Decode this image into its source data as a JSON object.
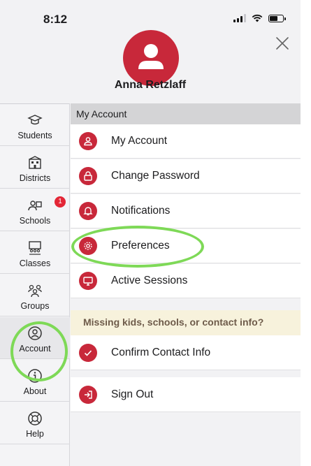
{
  "status_bar": {
    "time": "8:12"
  },
  "header": {
    "user_name": "Anna Retzlaff"
  },
  "sidebar": {
    "items": [
      {
        "label": "Students",
        "icon": "graduation-cap-icon"
      },
      {
        "label": "Districts",
        "icon": "building-icon"
      },
      {
        "label": "Schools",
        "icon": "school-icon",
        "badge": "1"
      },
      {
        "label": "Classes",
        "icon": "classroom-icon"
      },
      {
        "label": "Groups",
        "icon": "group-icon"
      },
      {
        "label": "Account",
        "icon": "account-icon",
        "selected": true
      },
      {
        "label": "About",
        "icon": "info-icon"
      },
      {
        "label": "Help",
        "icon": "lifebuoy-icon"
      }
    ]
  },
  "main": {
    "section_title": "My Account",
    "rows": [
      {
        "label": "My Account",
        "icon": "person-icon"
      },
      {
        "label": "Change Password",
        "icon": "lock-icon"
      },
      {
        "label": "Notifications",
        "icon": "bell-icon"
      },
      {
        "label": "Preferences",
        "icon": "gear-icon"
      },
      {
        "label": "Active Sessions",
        "icon": "monitor-icon"
      }
    ],
    "notice": "Missing kids, schools, or contact info?",
    "confirm_label": "Confirm Contact Info",
    "signout_label": "Sign Out"
  },
  "colors": {
    "accent": "#c8283a",
    "highlight_ring": "#7ed957",
    "notice_bg": "#f7f2dc"
  }
}
